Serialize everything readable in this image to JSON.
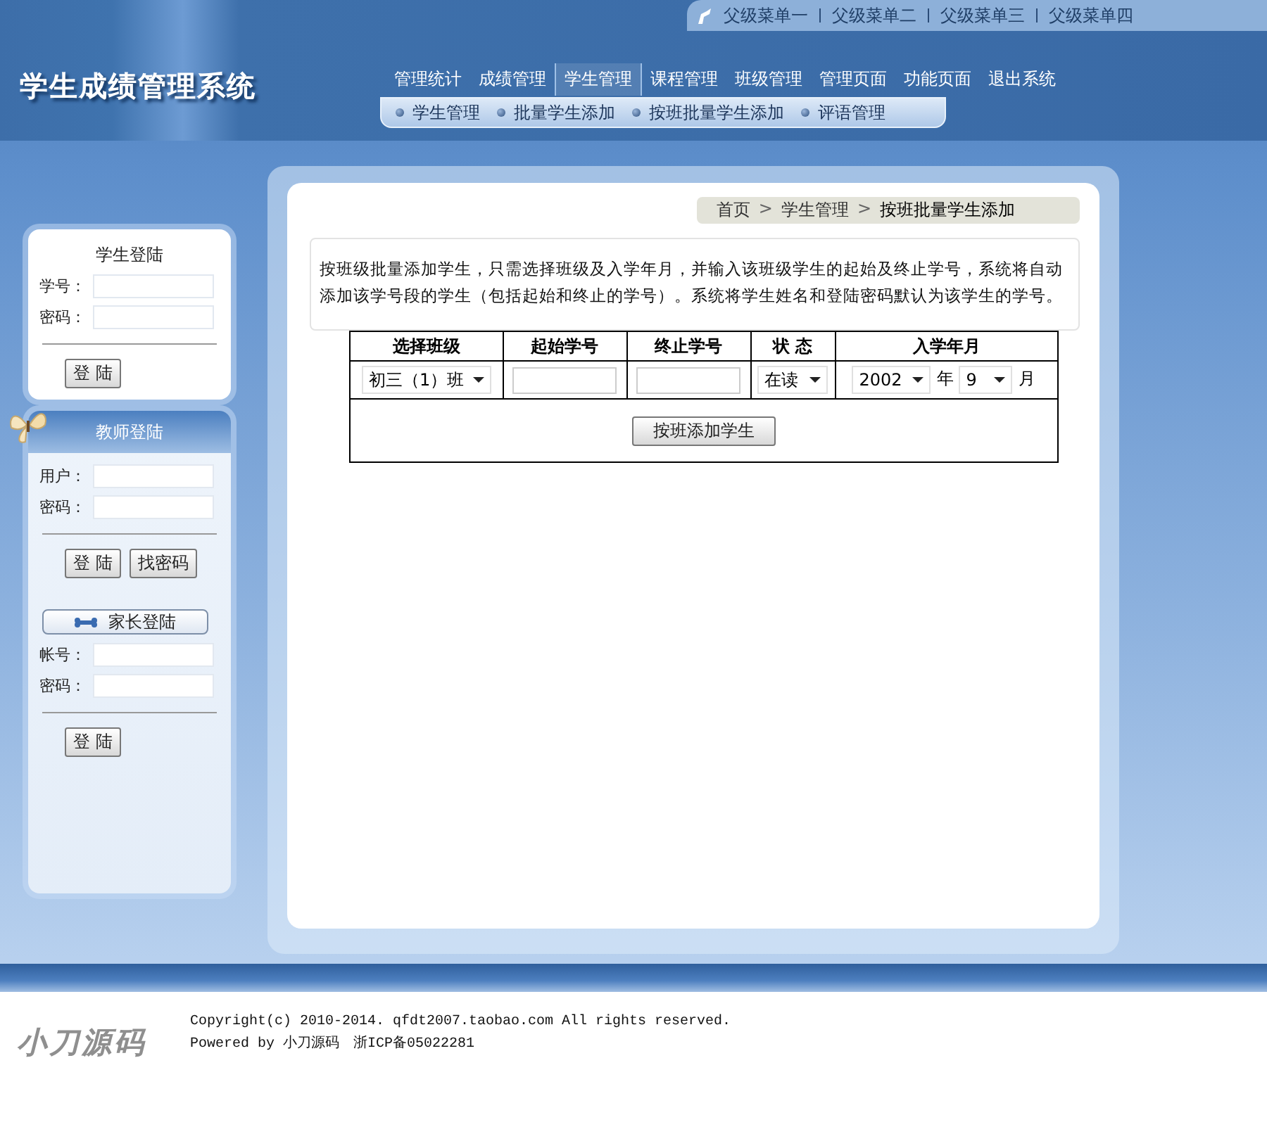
{
  "top_links": [
    {
      "label": "父级菜单一"
    },
    {
      "label": "父级菜单二"
    },
    {
      "label": "父级菜单三"
    },
    {
      "label": "父级菜单四"
    }
  ],
  "header": {
    "title": "学生成绩管理系统"
  },
  "nav": [
    {
      "label": "管理统计",
      "selected": false
    },
    {
      "label": "成绩管理",
      "selected": false
    },
    {
      "label": "学生管理",
      "selected": true
    },
    {
      "label": "课程管理",
      "selected": false
    },
    {
      "label": "班级管理",
      "selected": false
    },
    {
      "label": "管理页面",
      "selected": false
    },
    {
      "label": "功能页面",
      "selected": false
    },
    {
      "label": "退出系统",
      "selected": false
    }
  ],
  "subnav": [
    {
      "label": "学生管理"
    },
    {
      "label": "批量学生添加"
    },
    {
      "label": "按班批量学生添加"
    },
    {
      "label": "评语管理"
    }
  ],
  "student_login": {
    "title": "学生登陆",
    "fields": [
      {
        "label": "学号："
      },
      {
        "label": "密码："
      }
    ],
    "buttons": [
      "登 陆"
    ]
  },
  "teacher_login": {
    "title": "教师登陆",
    "fields": [
      {
        "label": "用户："
      },
      {
        "label": "密码："
      }
    ],
    "buttons": [
      "登 陆",
      "找密码"
    ]
  },
  "parent_login": {
    "title": "家长登陆",
    "fields": [
      {
        "label": "帐号："
      },
      {
        "label": "密码："
      }
    ],
    "buttons": [
      "登 陆"
    ]
  },
  "breadcrumb": [
    {
      "kind": "link",
      "text": "首页"
    },
    {
      "kind": "separator",
      "text": ">"
    },
    {
      "kind": "link",
      "text": "学生管理"
    },
    {
      "kind": "separator",
      "text": ">"
    },
    {
      "kind": "current",
      "text": "按班批量学生添加"
    }
  ],
  "intro": "按班级批量添加学生，只需选择班级及入学年月，并输入该班级学生的起始及终止学号，系统将自动添加该学号段的学生（包括起始和终止的学号）。系统将学生姓名和登陆密码默认为该学生的学号。",
  "form": {
    "columns": [
      "选择班级",
      "起始学号",
      "终止学号",
      "状 态",
      "入学年月"
    ],
    "class_select": "初三（1）班",
    "status_select": "在读",
    "year_select": "2002",
    "year_unit": "年",
    "month_select": "9",
    "month_unit": "月",
    "submit": "按班添加学生"
  },
  "footer": {
    "logo": "小刀源码",
    "copyright": "Copyright(c) 2010-2014. qfdt2007.taobao.com All rights reserved.",
    "powered": "Powered by 小刀源码　浙ICP备05022281"
  }
}
